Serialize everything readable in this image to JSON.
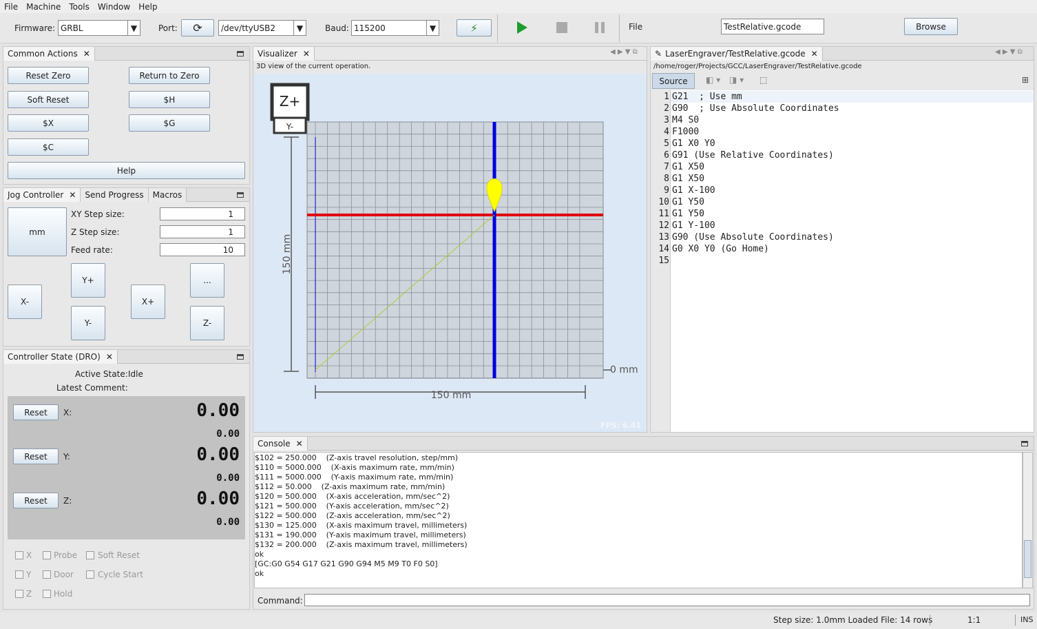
{
  "menu": [
    "File",
    "Machine",
    "Tools",
    "Window",
    "Help"
  ],
  "toolbar": {
    "firmware_label": "Firmware:",
    "firmware_value": "GRBL",
    "port_label": "Port:",
    "port_value": "/dev/ttyUSB2",
    "baud_label": "Baud:",
    "baud_value": "115200",
    "file_label": "File",
    "file_value": "TestRelative.gcode",
    "browse_label": "Browse"
  },
  "common_actions": {
    "tab": "Common Actions",
    "buttons": [
      "Reset Zero",
      "Return to Zero",
      "Soft Reset",
      "$H",
      "$X",
      "$G",
      "$C",
      "Help"
    ]
  },
  "jog": {
    "tabs": [
      "Jog Controller",
      "Send Progress",
      "Macros"
    ],
    "unit_button": "mm",
    "xy_step_label": "XY Step size:",
    "xy_step_value": "1",
    "z_step_label": "Z Step size:",
    "z_step_value": "1",
    "feed_label": "Feed rate:",
    "feed_value": "10",
    "buttons": {
      "xm": "X-",
      "xp": "X+",
      "yp": "Y+",
      "ym": "Y-",
      "zp": "...",
      "zm": "Z-"
    }
  },
  "dro": {
    "tab": "Controller State (DRO)",
    "active_state_label": "Active State:",
    "active_state_value": "Idle",
    "latest_comment_label": "Latest Comment:",
    "reset_label": "Reset",
    "axes": [
      {
        "name": "X:",
        "work": "0.00",
        "machine": "0.00"
      },
      {
        "name": "Y:",
        "work": "0.00",
        "machine": "0.00"
      },
      {
        "name": "Z:",
        "work": "0.00",
        "machine": "0.00"
      }
    ],
    "flags": [
      [
        "X",
        "Probe",
        "Soft Reset"
      ],
      [
        "Y",
        "Door",
        "Cycle Start"
      ],
      [
        "Z",
        "Hold",
        ""
      ]
    ]
  },
  "visualizer": {
    "tab": "Visualizer",
    "caption": "3D view of the current operation.",
    "cube_top": "Z+",
    "cube_front": "Y-",
    "y_dim": "150 mm",
    "x_dim": "150 mm",
    "zero": "0 mm",
    "fps": "FPS: 6.41"
  },
  "editor": {
    "tab": "LaserEngraver/TestRelative.gcode",
    "path": "/home/roger/Projects/GCC/LaserEngraver/TestRelative.gcode",
    "source_tab": "Source",
    "lines": [
      "G21  ; Use mm",
      "G90  ; Use Absolute Coordinates",
      "M4 S0",
      "F1000",
      "G1 X0 Y0",
      "G91 (Use Relative Coordinates)",
      "G1 X50",
      "G1 X50",
      "G1 X-100",
      "G1 Y50",
      "G1 Y50",
      "G1 Y-100",
      "G90 (Use Absolute Coordinates)",
      "G0 X0 Y0 (Go Home)",
      ""
    ]
  },
  "console": {
    "tab": "Console",
    "lines": [
      "$102 = 250.000    (Z-axis travel resolution, step/mm)",
      "$110 = 5000.000    (X-axis maximum rate, mm/min)",
      "$111 = 5000.000    (Y-axis maximum rate, mm/min)",
      "$112 = 50.000    (Z-axis maximum rate, mm/min)",
      "$120 = 500.000    (X-axis acceleration, mm/sec^2)",
      "$121 = 500.000    (Y-axis acceleration, mm/sec^2)",
      "$122 = 500.000    (Z-axis acceleration, mm/sec^2)",
      "$130 = 125.000    (X-axis maximum travel, millimeters)",
      "$131 = 190.000    (Y-axis maximum travel, millimeters)",
      "$132 = 200.000    (Z-axis maximum travel, millimeters)",
      "ok",
      "[GC:G0 G54 G17 G21 G90 G94 M5 M9 T0 F0 S0]",
      "ok"
    ],
    "command_label": "Command:"
  },
  "status": {
    "step_loaded": "Step size: 1.0mm Loaded File: 14 rows",
    "ratio": "1:1",
    "mode": "INS"
  },
  "colors": {
    "accent": "#1c9c2a",
    "x_axis": "#e00000",
    "y_axis": "#0000dd",
    "tool": "#ffff00"
  }
}
